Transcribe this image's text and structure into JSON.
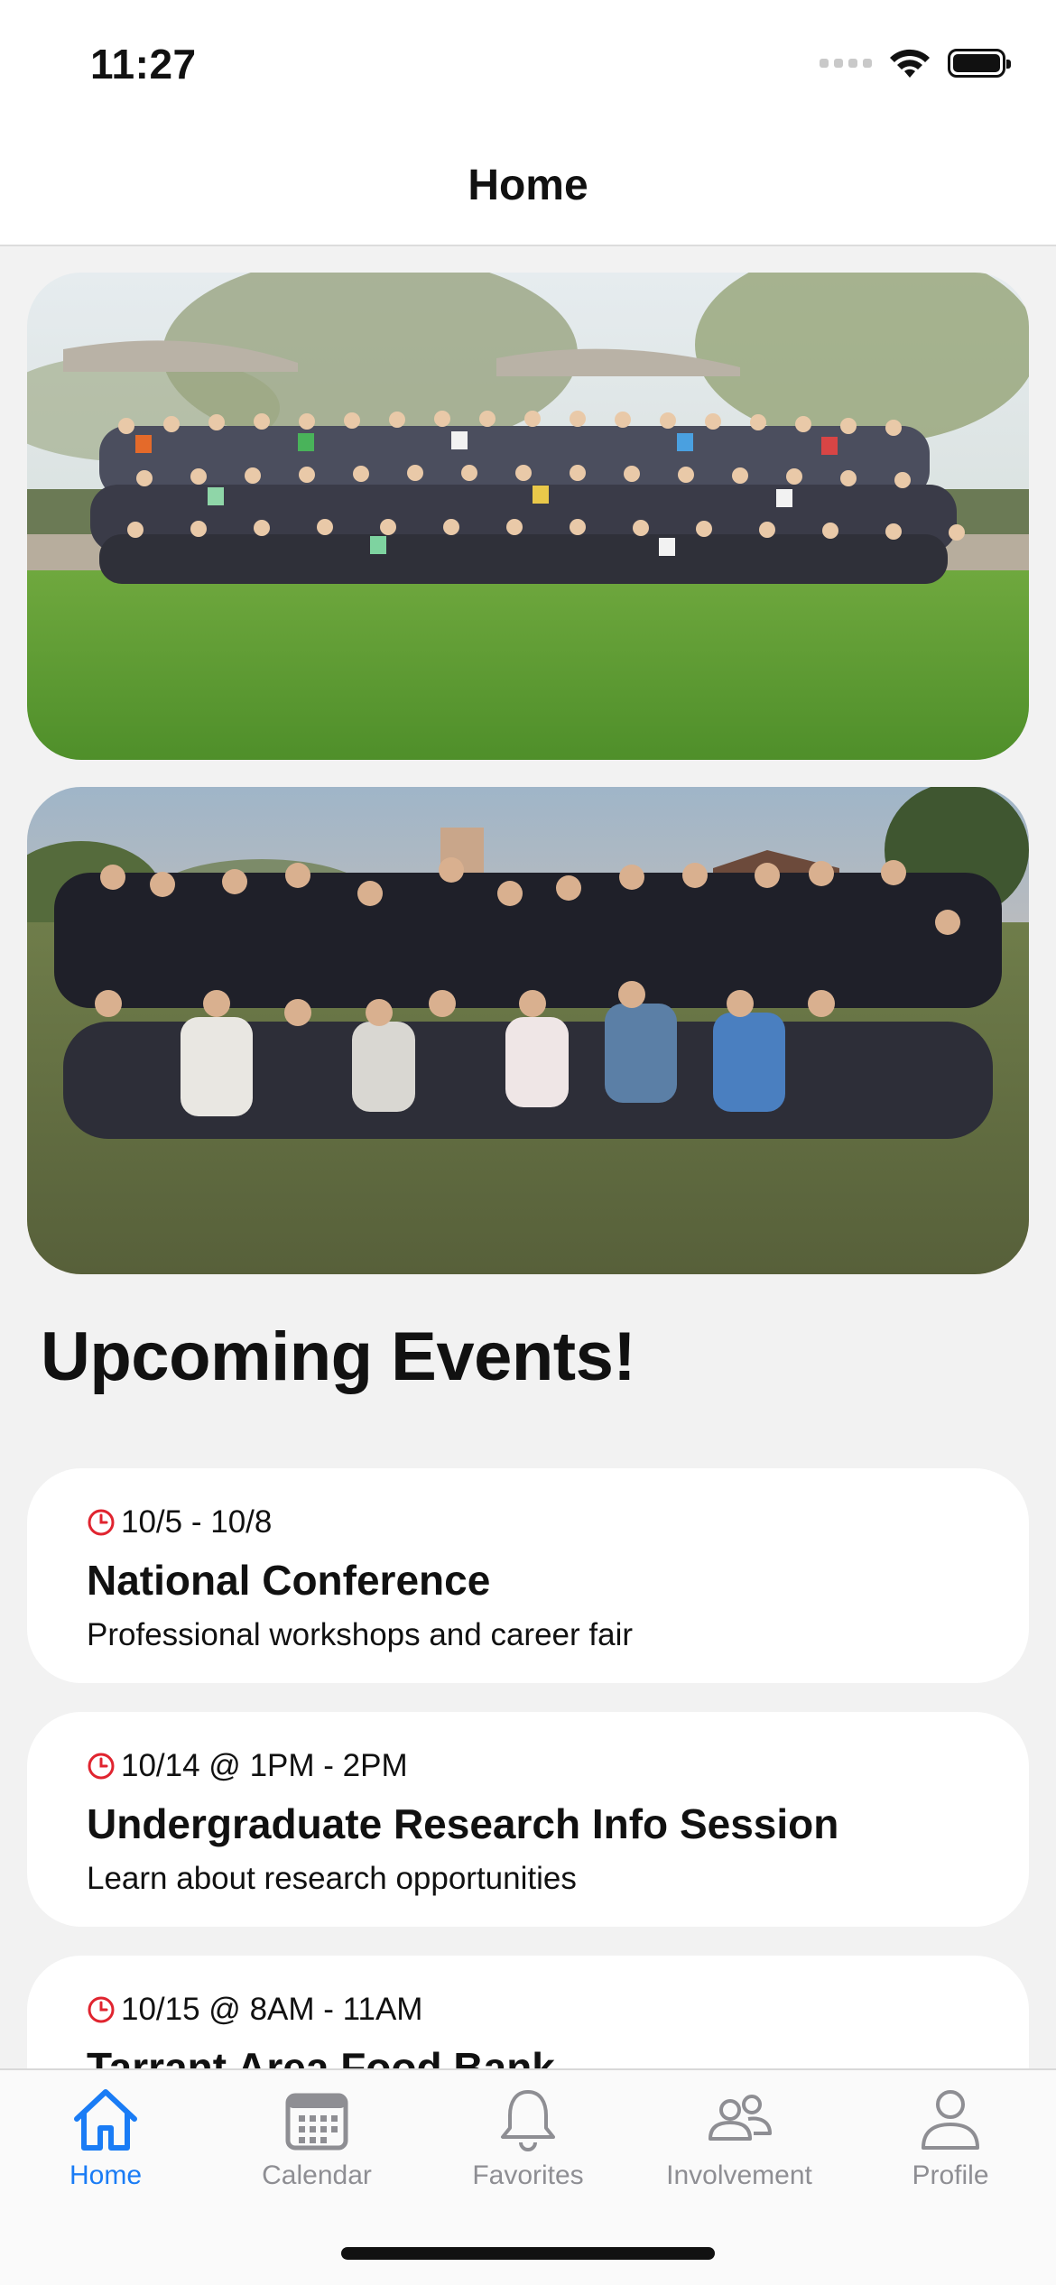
{
  "status_bar": {
    "time": "11:27"
  },
  "header": {
    "title": "Home"
  },
  "photos": [
    {
      "alt": "group-photo-park"
    },
    {
      "alt": "group-photo-evening"
    }
  ],
  "section": {
    "title": "Upcoming Events!"
  },
  "events": [
    {
      "date": "10/5 - 10/8",
      "title": "National Conference",
      "description": "Professional workshops and career fair"
    },
    {
      "date": "10/14 @ 1PM - 2PM",
      "title": "Undergraduate Research Info Session",
      "description": "Learn about research opportunities"
    },
    {
      "date": "10/15 @ 8AM - 11AM",
      "title": "Tarrant Area Food Bank",
      "description": ""
    }
  ],
  "tabs": [
    {
      "label": "Home",
      "icon": "house-icon",
      "active": true
    },
    {
      "label": "Calendar",
      "icon": "calendar-icon",
      "active": false
    },
    {
      "label": "Favorites",
      "icon": "bell-icon",
      "active": false
    },
    {
      "label": "Involvement",
      "icon": "people-icon",
      "active": false
    },
    {
      "label": "Profile",
      "icon": "person-icon",
      "active": false
    }
  ],
  "colors": {
    "accent": "#1a7cf5",
    "clock_red": "#e0242f",
    "inactive": "#8e8e93"
  }
}
